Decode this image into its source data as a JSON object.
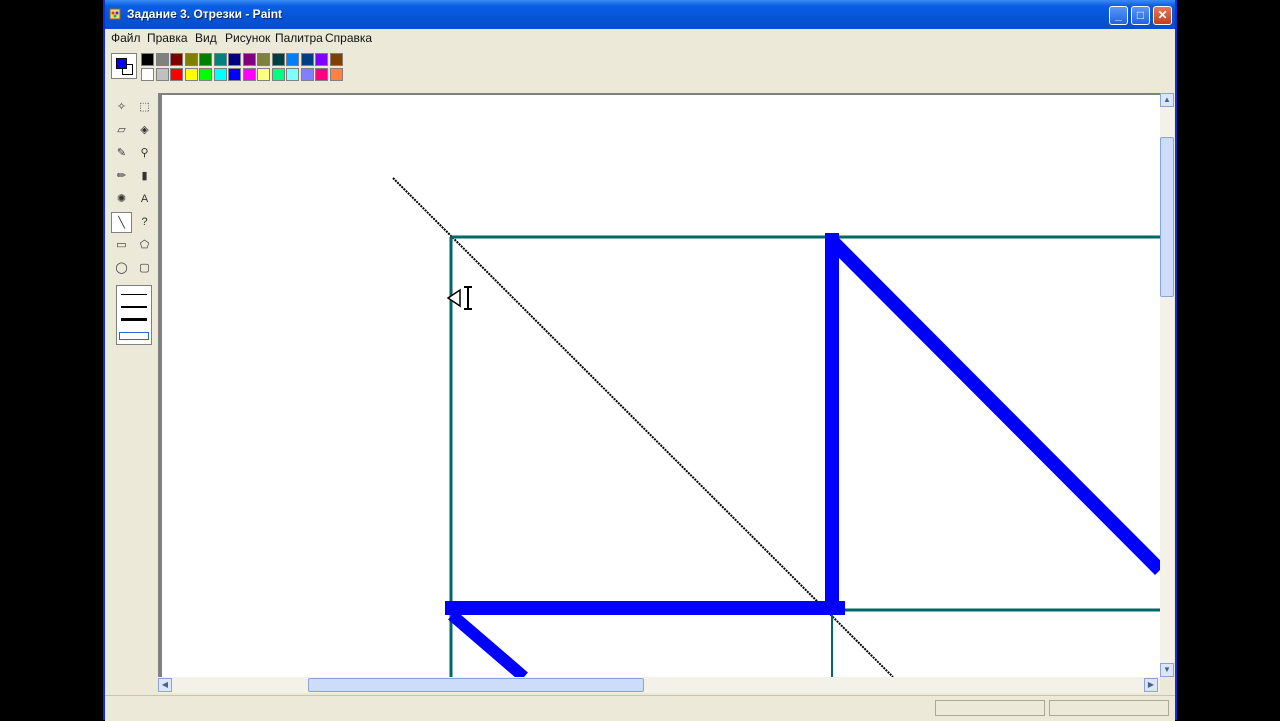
{
  "window": {
    "title": "Задание 3. Отрезки - Paint",
    "minimize_label": "_",
    "maximize_label": "□",
    "close_label": "✕"
  },
  "menu": {
    "items": [
      {
        "label": "Файл"
      },
      {
        "label": "Правка"
      },
      {
        "label": "Вид"
      },
      {
        "label": "Рисунок"
      },
      {
        "label": "Палитра"
      },
      {
        "label": "Справка"
      }
    ]
  },
  "palette": {
    "foreground": "#0000ff",
    "background": "#ffffff",
    "colors_top": [
      "#000000",
      "#808080",
      "#800000",
      "#808000",
      "#008000",
      "#008080",
      "#000080",
      "#800080",
      "#808040",
      "#004040",
      "#0080ff",
      "#004080",
      "#8000ff",
      "#804000"
    ],
    "colors_bottom": [
      "#ffffff",
      "#c0c0c0",
      "#ff0000",
      "#ffff00",
      "#00ff00",
      "#00ffff",
      "#0000ff",
      "#ff00ff",
      "#ffff80",
      "#00ff80",
      "#80ffff",
      "#8080ff",
      "#ff0080",
      "#ff8040"
    ]
  },
  "tools": [
    {
      "icon": "free-select-icon",
      "glyph": "✧"
    },
    {
      "icon": "rect-select-icon",
      "glyph": "⬚"
    },
    {
      "icon": "eraser-icon",
      "glyph": "▱"
    },
    {
      "icon": "fill-icon",
      "glyph": "◈"
    },
    {
      "icon": "color-picker-icon",
      "glyph": "✎"
    },
    {
      "icon": "magnifier-icon",
      "glyph": "⚲"
    },
    {
      "icon": "pencil-icon",
      "glyph": "✏"
    },
    {
      "icon": "brush-icon",
      "glyph": "▮"
    },
    {
      "icon": "airbrush-icon",
      "glyph": "✺"
    },
    {
      "icon": "text-icon",
      "glyph": "A"
    },
    {
      "icon": "line-icon",
      "glyph": "╲"
    },
    {
      "icon": "curve-icon",
      "glyph": "?"
    },
    {
      "icon": "rectangle-icon",
      "glyph": "▭"
    },
    {
      "icon": "polygon-icon",
      "glyph": "⬠"
    },
    {
      "icon": "ellipse-icon",
      "glyph": "◯"
    },
    {
      "icon": "rounded-rect-icon",
      "glyph": "▢"
    }
  ],
  "active_tool": "line-icon",
  "colors": {
    "teal_lines": "#006666",
    "blue_lines": "#0000ff",
    "black_line": "#000000"
  },
  "statusbar": {
    "help_text": "",
    "coords": ""
  }
}
